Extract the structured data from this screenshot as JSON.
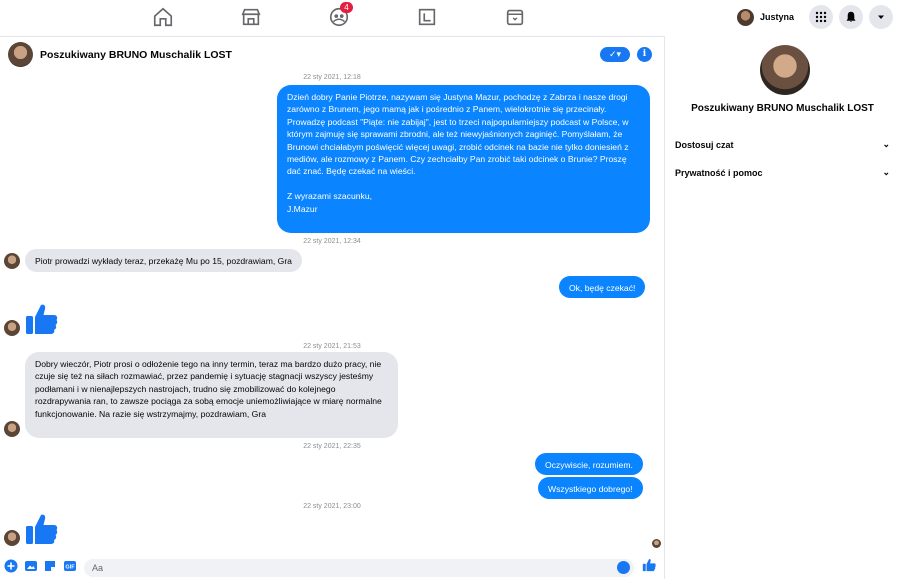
{
  "nav": {
    "notifications_count": "4",
    "user_name": "Justyna"
  },
  "chat": {
    "title": "Poszukiwany BRUNO Muschalik LOST",
    "check_label": "✓▾",
    "info_label": "i"
  },
  "messages": {
    "ts1": "22 sty 2021, 12:18",
    "m1": "Dzień dobry Panie Piotrze, nazywam się Justyna Mazur, pochodzę z Zabrza i nasze drogi zarówno z Brunem, jego mamą jak i pośrednio z Panem, wielokrotnie się przecinały. Prowadzę podcast \"Piąte: nie zabijaj\", jest to trzeci najpopularniejszy podcast w Polsce, w którym zajmuję się sprawami zbrodni, ale też niewyjaśnionych zaginięć. Pomyślałam, że Brunowi chciałabym poświęcić więcej uwagi, zrobić odcinek na bazie nie tylko doniesień z mediów, ale rozmowy z Panem. Czy zechciałby Pan zrobić taki odcinek o Brunie? Proszę dać znać. Będę czekać na wieści.\n\nZ wyrazami szacunku,\nJ.Mazur",
    "ts2": "22 sty 2021, 12:34",
    "m2": "Piotr prowadzi wykłady teraz, przekażę Mu po 15, pozdrawiam, Gra",
    "m3": "Ok, będę czekać!",
    "ts3": "22 sty 2021, 21:53",
    "m4": "Dobry wieczór, Piotr prosi o odłożenie tego na inny termin, teraz ma bardzo dużo pracy, nie czuje się też na siłach rozmawiać, przez pandemię i sytuację stagnacji wszyscy jesteśmy podłamani i w nienajlepszych nastrojach, trudno się zmobilizować do kolejnego rozdrapywania ran, to zawsze pociąga za sobą emocje uniemożliwiające w miarę normalne funkcjonowanie. Na razie się wstrzymajmy, pozdrawiam, Gra",
    "ts4": "22 sty 2021, 22:35",
    "m5": "Oczywiscie, rozumiem.",
    "m6": "Wszystkiego dobrego!",
    "ts5": "22 sty 2021, 23:00"
  },
  "composer": {
    "placeholder": "Aa"
  },
  "right_panel": {
    "name": "Poszukiwany BRUNO Muschalik LOST",
    "customize": "Dostosuj czat",
    "privacy": "Prywatność i pomoc"
  },
  "colors": {
    "accent": "#1877f2",
    "outgoing_bubble": "#0a84ff",
    "incoming_bubble": "#e4e6eb"
  }
}
